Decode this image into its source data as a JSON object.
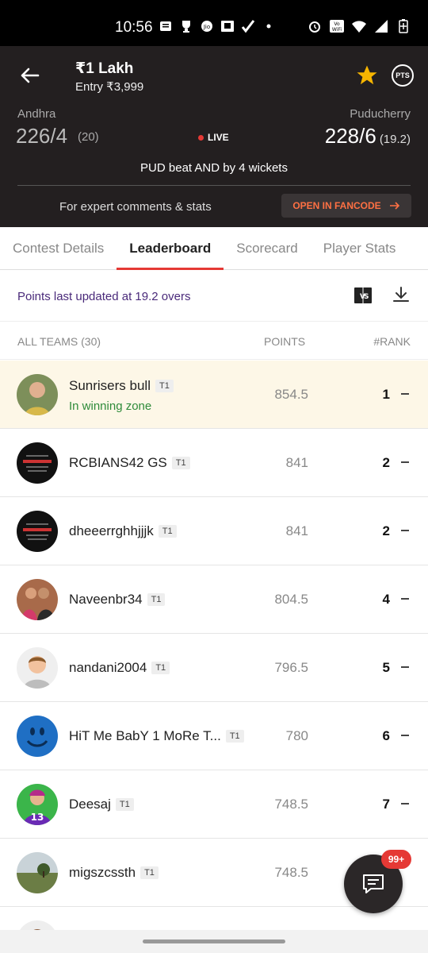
{
  "status_bar": {
    "time": "10:56"
  },
  "header": {
    "title": "₹1 Lakh",
    "entry": "Entry ₹3,999",
    "pts_label": "PTS",
    "team_left": {
      "name": "Andhra",
      "score": "226/4",
      "overs": "(20)"
    },
    "team_right": {
      "name": "Puducherry",
      "score": "228/6",
      "overs": "(19.2)"
    },
    "live_label": "LIVE",
    "result": "PUD beat AND by 4 wickets",
    "expert_text": "For expert comments & stats",
    "fancode_label": "OPEN IN FANCODE"
  },
  "tabs": [
    "Contest Details",
    "Leaderboard",
    "Scorecard",
    "Player Stats"
  ],
  "updated_text": "Points last updated at 19.2 overs",
  "columns": {
    "teams": "ALL TEAMS (30)",
    "points": "POINTS",
    "rank": "#RANK"
  },
  "rows": [
    {
      "name": "Sunrisers bull",
      "badge": "T1",
      "zone": "In winning zone",
      "points": "854.5",
      "rank": "1"
    },
    {
      "name": "RCBIANS42 GS",
      "badge": "T1",
      "points": "841",
      "rank": "2"
    },
    {
      "name": "dheeerrghhjjjk",
      "badge": "T1",
      "points": "841",
      "rank": "2"
    },
    {
      "name": "Naveenbr34",
      "badge": "T1",
      "points": "804.5",
      "rank": "4"
    },
    {
      "name": "nandani2004",
      "badge": "T1",
      "points": "796.5",
      "rank": "5"
    },
    {
      "name": "HiT Me BabY 1 MoRe T...",
      "badge": "T1",
      "points": "780",
      "rank": "6"
    },
    {
      "name": "Deesaj",
      "badge": "T1",
      "points": "748.5",
      "rank": "7"
    },
    {
      "name": "migszcssth",
      "badge": "T1",
      "points": "748.5",
      "rank": ""
    }
  ],
  "chat_badge": "99+",
  "colors": {
    "accent_red": "#e53935",
    "header_bg": "#231f20",
    "winning_green": "#2e8b3a",
    "highlight_bg": "#fdf7e7"
  }
}
